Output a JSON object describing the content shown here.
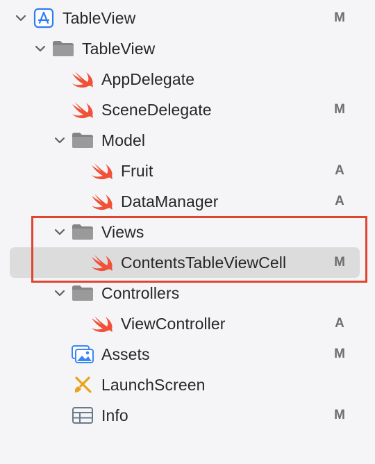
{
  "navigator": {
    "items": [
      {
        "label": "TableView",
        "status": "M",
        "icon": "xcode-project-icon",
        "expanded": true
      },
      {
        "label": "TableView",
        "status": "",
        "icon": "folder-icon",
        "expanded": true
      },
      {
        "label": "AppDelegate",
        "status": "",
        "icon": "swift-file-icon"
      },
      {
        "label": "SceneDelegate",
        "status": "M",
        "icon": "swift-file-icon"
      },
      {
        "label": "Model",
        "status": "",
        "icon": "folder-icon",
        "expanded": true
      },
      {
        "label": "Fruit",
        "status": "A",
        "icon": "swift-file-icon"
      },
      {
        "label": "DataManager",
        "status": "A",
        "icon": "swift-file-icon"
      },
      {
        "label": "Views",
        "status": "",
        "icon": "folder-icon",
        "expanded": true
      },
      {
        "label": "ContentsTableViewCell",
        "status": "M",
        "icon": "swift-file-icon",
        "selected": true
      },
      {
        "label": "Controllers",
        "status": "",
        "icon": "folder-icon",
        "expanded": true
      },
      {
        "label": "ViewController",
        "status": "A",
        "icon": "swift-file-icon"
      },
      {
        "label": "Assets",
        "status": "M",
        "icon": "asset-catalog-icon"
      },
      {
        "label": "LaunchScreen",
        "status": "",
        "icon": "storyboard-icon"
      },
      {
        "label": "Info",
        "status": "M",
        "icon": "plist-icon"
      }
    ]
  },
  "colors": {
    "swift": "#f05138",
    "folder": "#848484",
    "xcode_blue": "#2f7cf6",
    "highlight_border": "#e0452f",
    "selection_bg": "#dcdcdc"
  }
}
